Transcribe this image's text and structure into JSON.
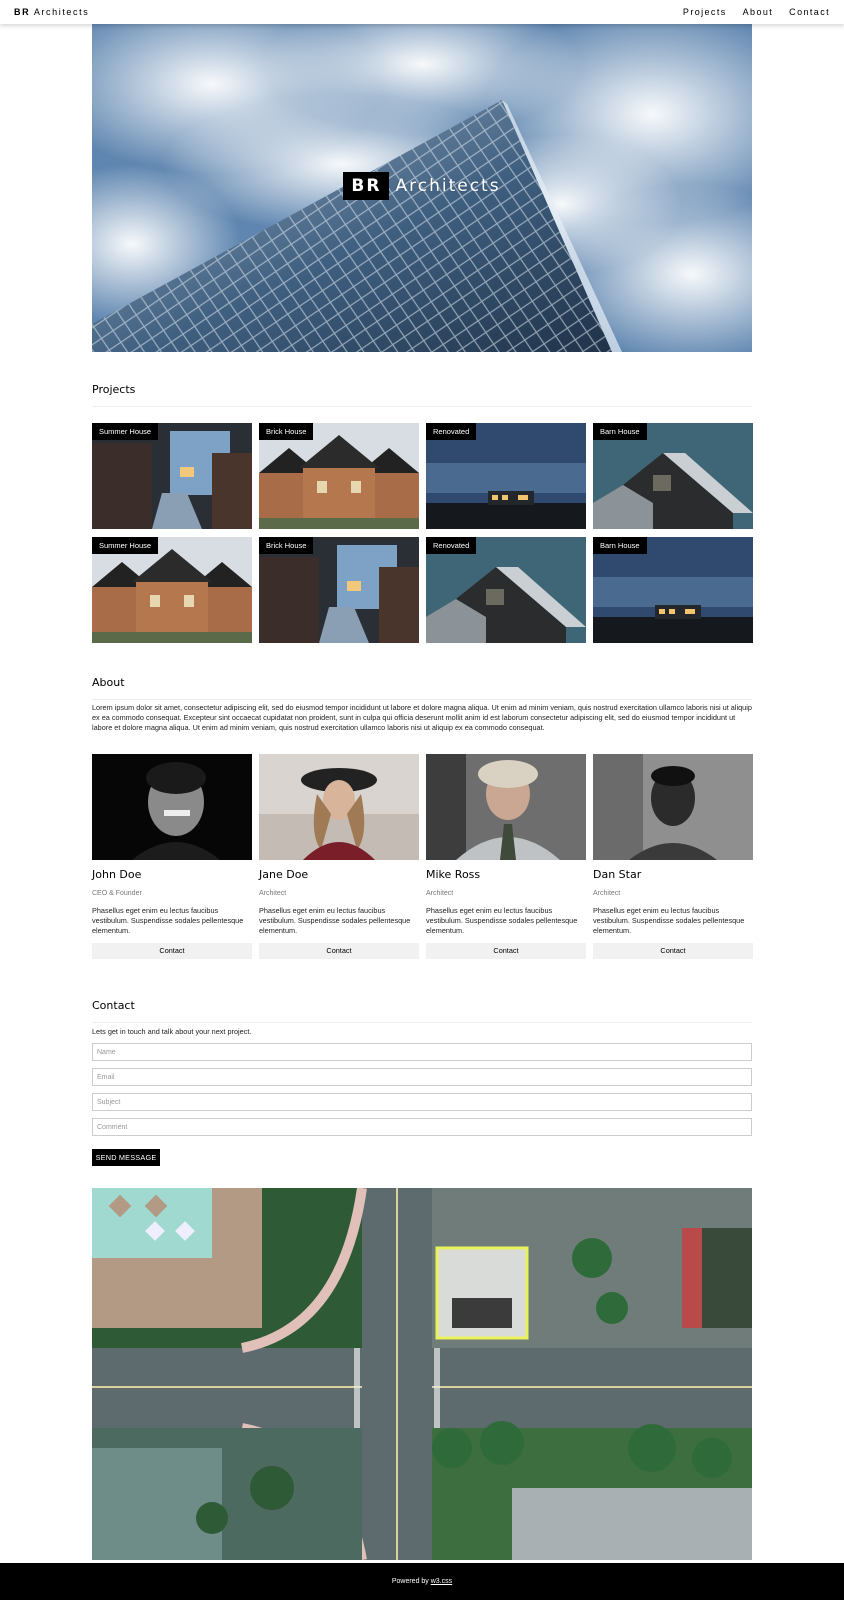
{
  "nav": {
    "brand_bold": "BR",
    "brand_rest": "Architects",
    "links": [
      "Projects",
      "About",
      "Contact"
    ]
  },
  "hero": {
    "title_bold": "BR",
    "title_rest": "Architects"
  },
  "projects": {
    "heading": "Projects",
    "items": [
      {
        "label": "Summer House"
      },
      {
        "label": "Brick House"
      },
      {
        "label": "Renovated"
      },
      {
        "label": "Barn House"
      },
      {
        "label": "Summer House"
      },
      {
        "label": "Brick House"
      },
      {
        "label": "Renovated"
      },
      {
        "label": "Barn House"
      }
    ]
  },
  "about": {
    "heading": "About",
    "text": "Lorem ipsum dolor sit amet, consectetur adipiscing elit, sed do eiusmod tempor incididunt ut labore et dolore magna aliqua. Ut enim ad minim veniam, quis nostrud exercitation ullamco laboris nisi ut aliquip ex ea commodo consequat. Excepteur sint occaecat cupidatat non proident, sunt in culpa qui officia deserunt mollit anim id est laborum consectetur adipiscing elit, sed do eiusmod tempor incididunt ut labore et dolore magna aliqua. Ut enim ad minim veniam, quis nostrud exercitation ullamco laboris nisi ut aliquip ex ea commodo consequat.",
    "team": [
      {
        "name": "John Doe",
        "role": "CEO & Founder",
        "desc": "Phasellus eget enim eu lectus faucibus vestibulum. Suspendisse sodales pellentesque elementum.",
        "button": "Contact"
      },
      {
        "name": "Jane Doe",
        "role": "Architect",
        "desc": "Phasellus eget enim eu lectus faucibus vestibulum. Suspendisse sodales pellentesque elementum.",
        "button": "Contact"
      },
      {
        "name": "Mike Ross",
        "role": "Architect",
        "desc": "Phasellus eget enim eu lectus faucibus vestibulum. Suspendisse sodales pellentesque elementum.",
        "button": "Contact"
      },
      {
        "name": "Dan Star",
        "role": "Architect",
        "desc": "Phasellus eget enim eu lectus faucibus vestibulum. Suspendisse sodales pellentesque elementum.",
        "button": "Contact"
      }
    ]
  },
  "contact": {
    "heading": "Contact",
    "lead": "Lets get in touch and talk about your next project.",
    "placeholders": {
      "name": "Name",
      "email": "Email",
      "subject": "Subject",
      "comment": "Comment"
    },
    "send": "SEND MESSAGE"
  },
  "footer": {
    "prefix": "Powered by",
    "link": "w3.css"
  },
  "colors": {
    "accent": "#000000",
    "button_bg": "#f1f1f1",
    "footer_bg": "#000000"
  }
}
